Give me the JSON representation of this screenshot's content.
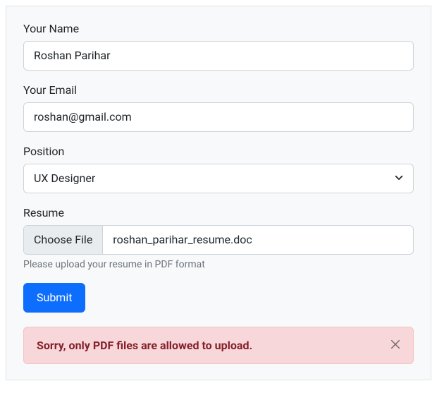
{
  "form": {
    "name": {
      "label": "Your Name",
      "value": "Roshan Parihar"
    },
    "email": {
      "label": "Your Email",
      "value": "roshan@gmail.com"
    },
    "position": {
      "label": "Position",
      "selected": "UX Designer"
    },
    "resume": {
      "label": "Resume",
      "choose_button": "Choose File",
      "filename": "roshan_parihar_resume.doc",
      "hint": "Please upload your resume in PDF format"
    },
    "submit_label": "Submit"
  },
  "alert": {
    "message": "Sorry, only PDF files are allowed to upload."
  }
}
